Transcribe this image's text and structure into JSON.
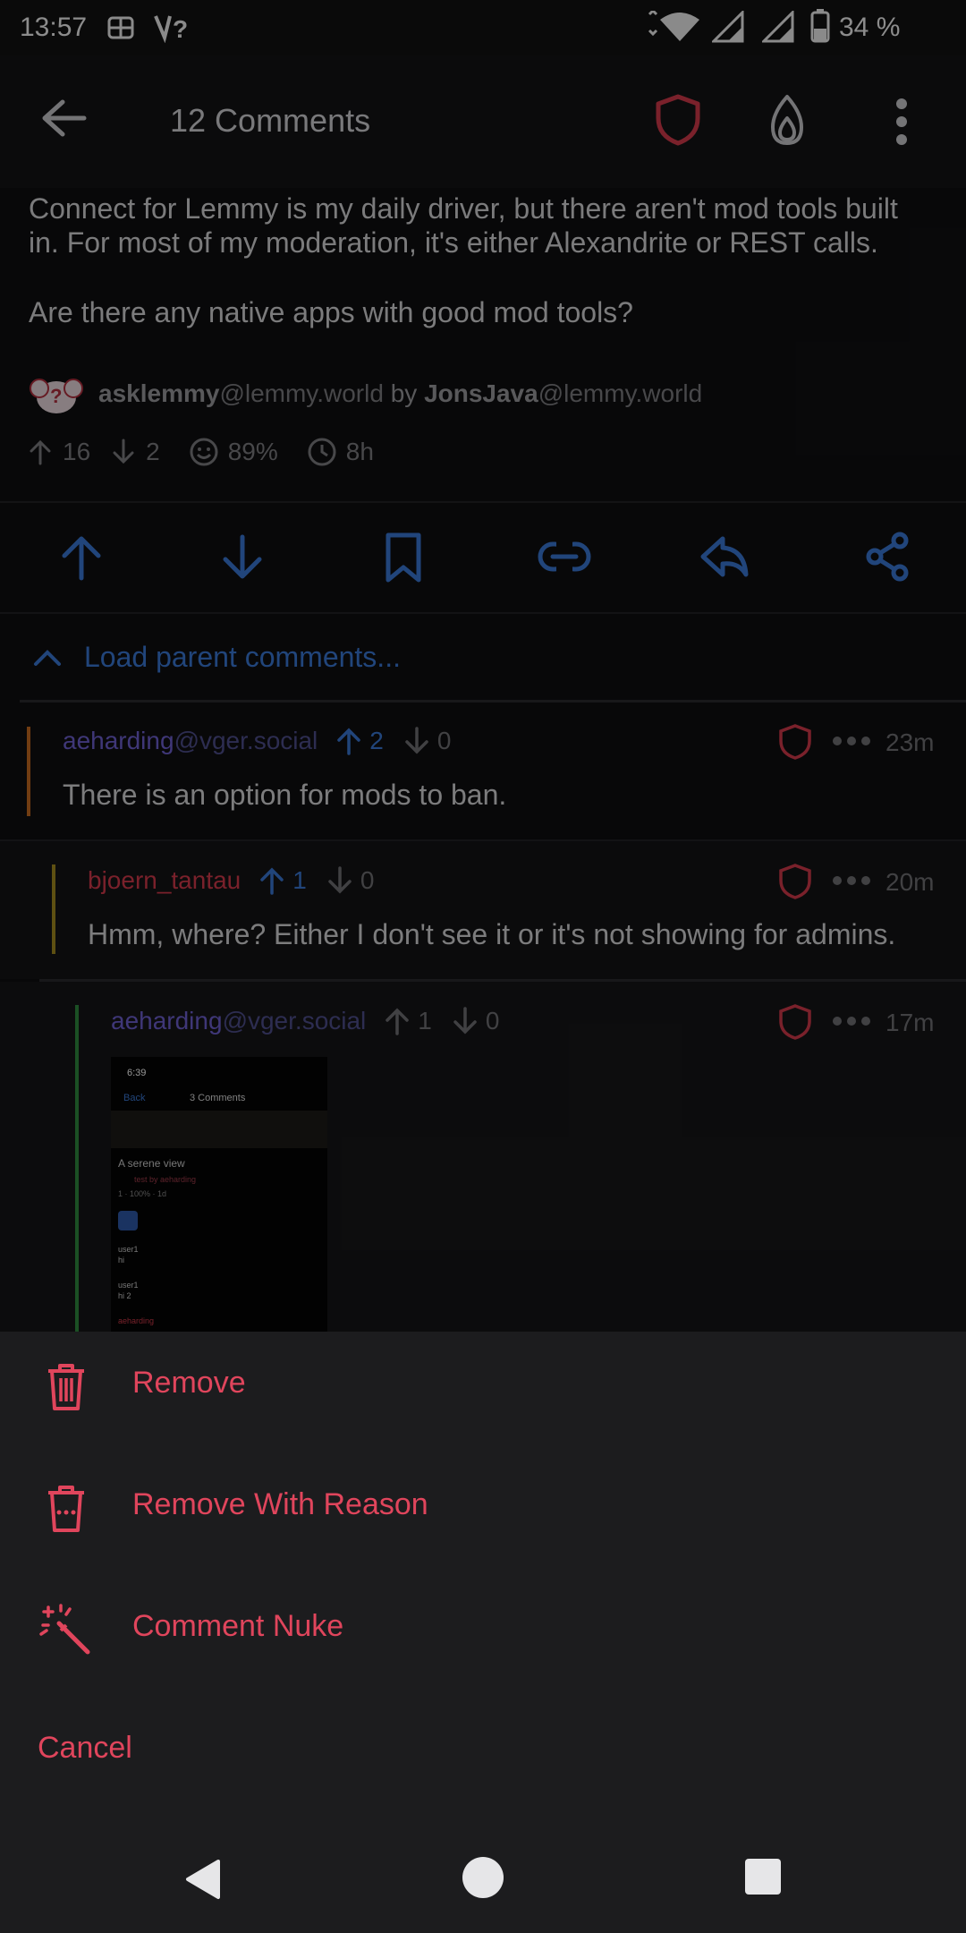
{
  "status_bar": {
    "time": "13:57",
    "battery": "34 %"
  },
  "toolbar": {
    "title": "12 Comments"
  },
  "post": {
    "body_line1": "Connect for Lemmy is my daily driver, but there aren't mod tools built",
    "body_line2": "in. For most of my moderation, it's either Alexandrite or REST calls.",
    "body_line3": "Are there any native apps with good mod tools?",
    "community": "asklemmy",
    "community_host": "@lemmy.world",
    "by": "by",
    "author": "JonsJava",
    "author_host": "@lemmy.world",
    "upvotes": "16",
    "downvotes": "2",
    "ratio": "89%",
    "age": "8h"
  },
  "load_parent": "Load parent comments...",
  "comments": [
    {
      "user": "aeharding",
      "host": "@vger.social",
      "up": "2",
      "down": "0",
      "time": "23m",
      "body": "There is an option for mods to ban.",
      "thread_color": "#c36a1f"
    },
    {
      "user": "bjoern_tantau",
      "host": "",
      "up": "1",
      "down": "0",
      "time": "20m",
      "body": "Hmm, where? Either I don't see it or it's not showing for admins.",
      "thread_color": "#a38a1f"
    },
    {
      "user": "aeharding",
      "host": "@vger.social",
      "up": "1",
      "down": "0",
      "time": "17m",
      "body": "",
      "thread_color": "#2f8a3e"
    }
  ],
  "thumbnail": {
    "time": "6:39",
    "back": "Back",
    "title": "3 Comments",
    "post_title": "A serene view",
    "post_meta": "test by aeharding",
    "stats": "1 · 100% · 1d",
    "row1": "user1",
    "row1b": "hi",
    "row2": "user1",
    "row2b": "hi 2",
    "row3": "aeharding"
  },
  "sheet": {
    "remove": "Remove",
    "remove_reason": "Remove With Reason",
    "nuke": "Comment Nuke",
    "cancel": "Cancel"
  },
  "colors": {
    "accent_blue": "#3a78d4",
    "danger": "#e0455c",
    "background": "#0f0f11"
  }
}
